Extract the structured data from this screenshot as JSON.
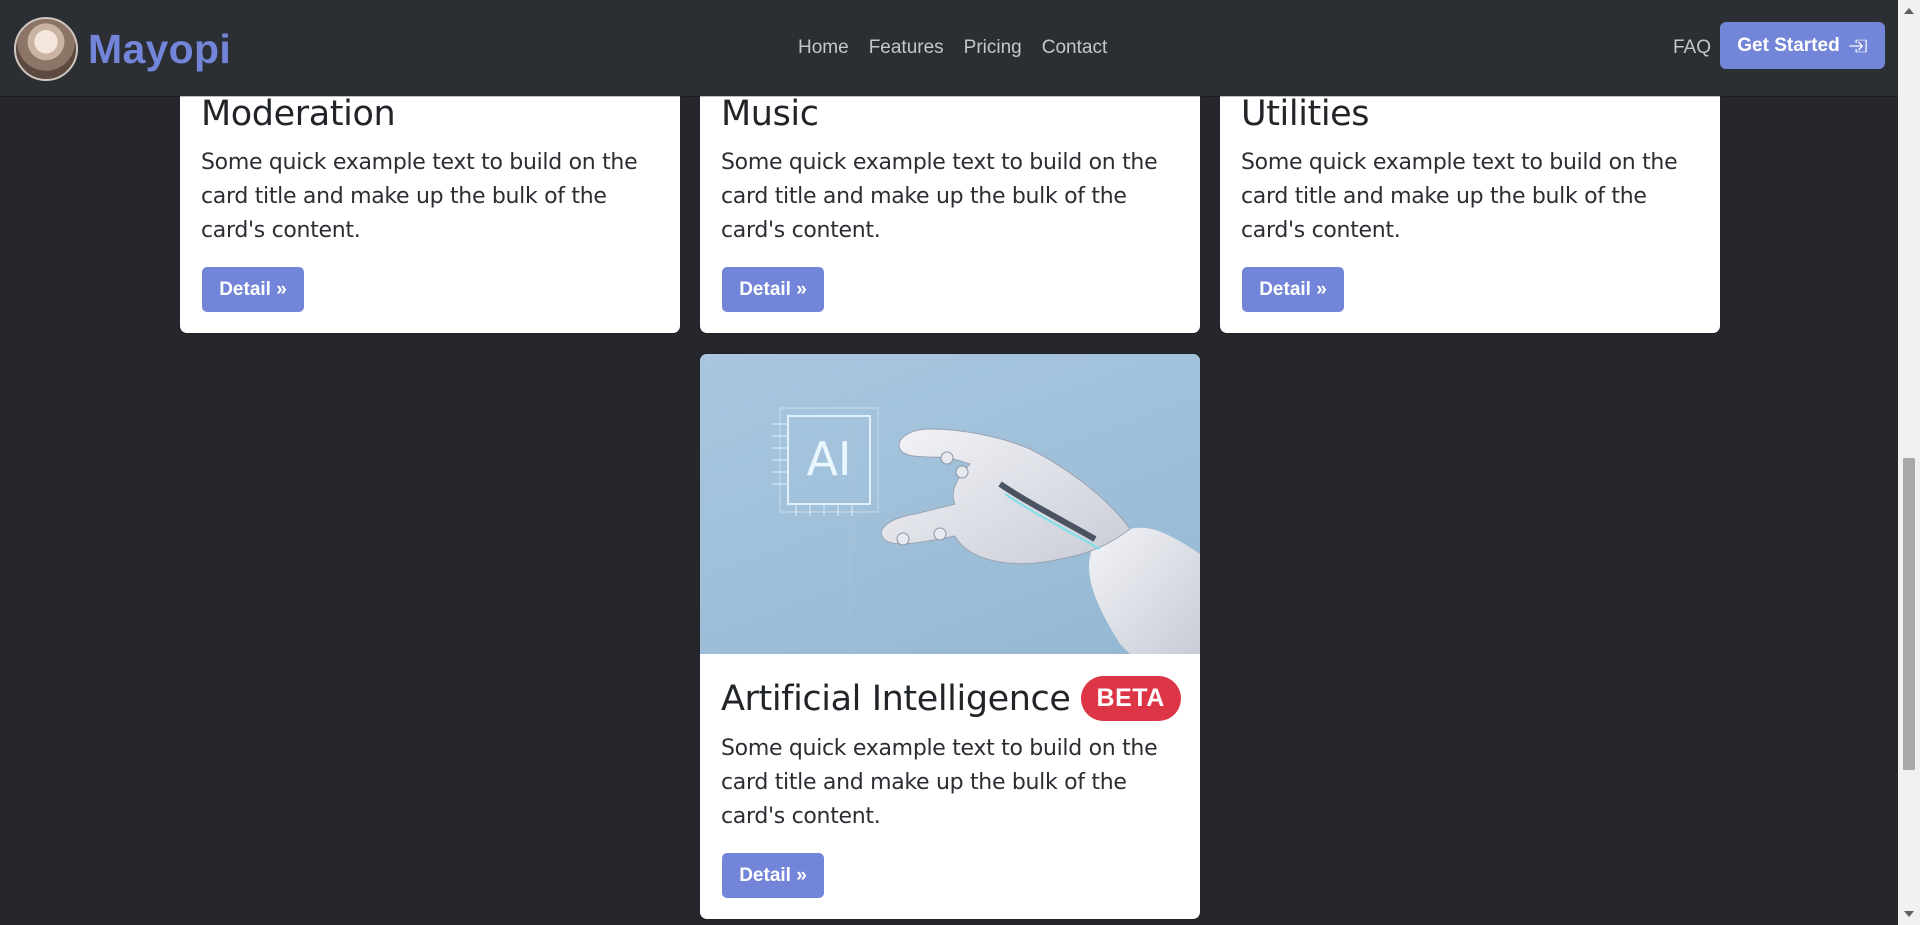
{
  "navbar": {
    "brand": "Mayopi",
    "links": [
      "Home",
      "Features",
      "Pricing",
      "Contact"
    ],
    "faq": "FAQ",
    "cta_label": "Get Started"
  },
  "cards": [
    {
      "title": "Moderation",
      "text": "Some quick example text to build on the card title and make up the bulk of the card's content.",
      "button": "Detail »"
    },
    {
      "title": "Music",
      "text": "Some quick example text to build on the card title and make up the bulk of the card's content.",
      "button": "Detail »"
    },
    {
      "title": "Utilities",
      "text": "Some quick example text to build on the card title and make up the bulk of the card's content.",
      "button": "Detail »"
    },
    {
      "title": "Artificial Intelligence",
      "badge": "BETA",
      "image_label": "AI",
      "text": "Some quick example text to build on the card title and make up the bulk of the card's content.",
      "button": "Detail »"
    }
  ],
  "colors": {
    "page_bg": "#25272c",
    "navbar_bg": "#2b2e33",
    "accent": "#7285d8",
    "badge": "#dc3545"
  },
  "icons": {
    "cta_icon": "sign-in-icon"
  }
}
